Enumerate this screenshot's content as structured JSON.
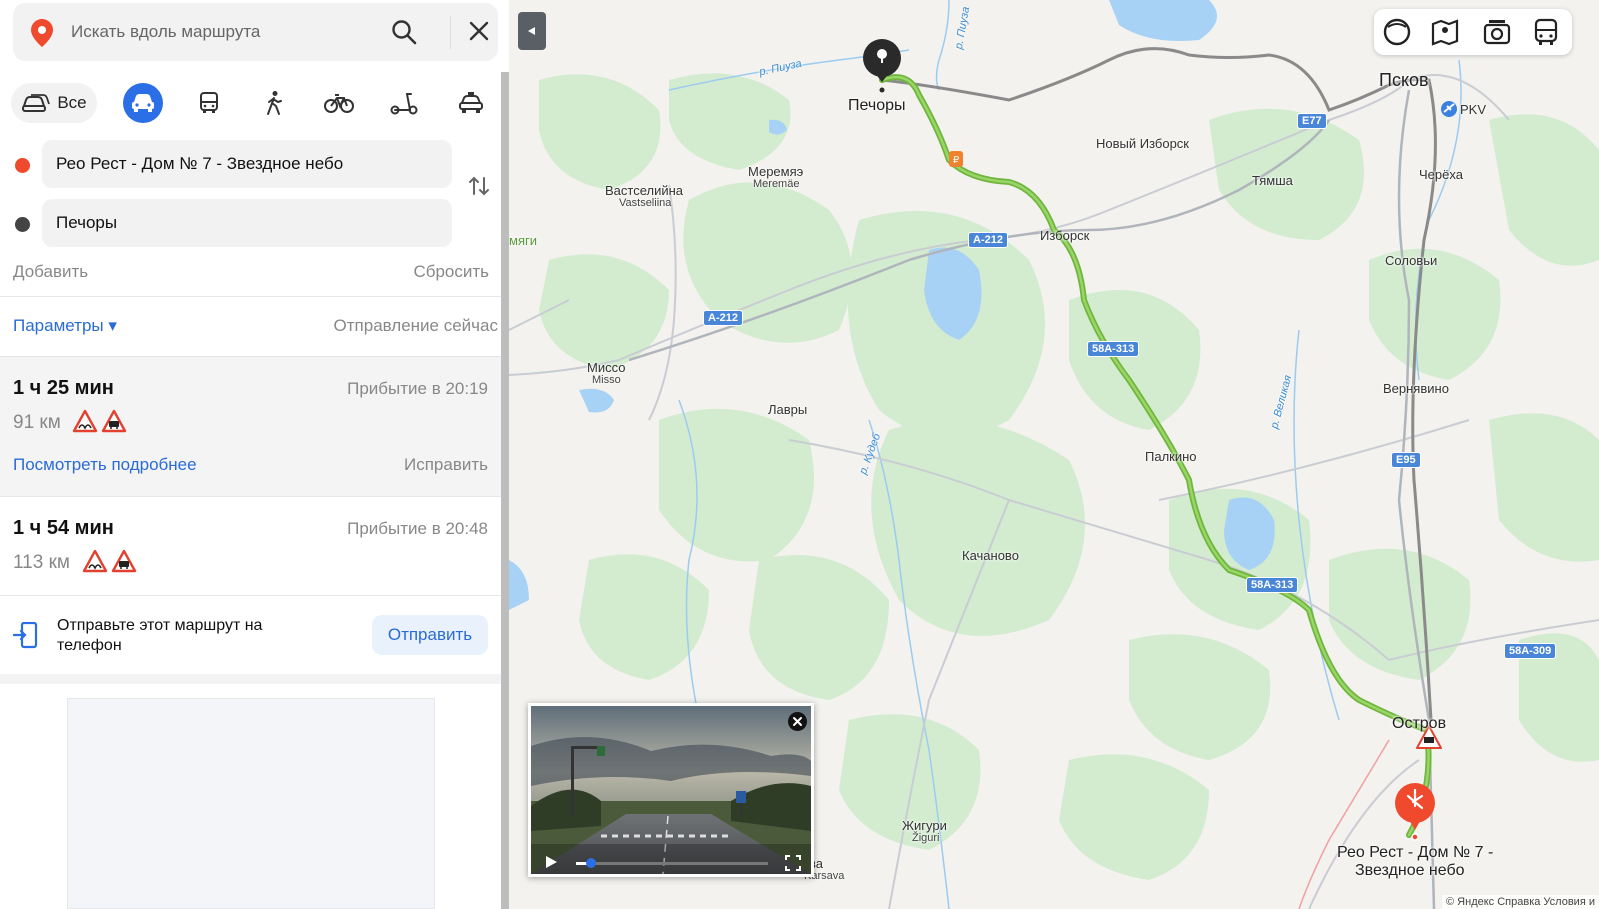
{
  "search": {
    "placeholder": "Искать вдоль маршрута"
  },
  "modes": {
    "all_label": "Все",
    "active": "car"
  },
  "points": {
    "from": "Рео Рест - Дом № 7 - Звездное небо",
    "to": "Печоры"
  },
  "actions": {
    "add": "Добавить",
    "reset": "Сбросить"
  },
  "params": {
    "label": "Параметры ▾",
    "departure": "Отправление сейчас"
  },
  "routes": [
    {
      "time": "1 ч 25 мин",
      "arrival": "Прибытие в 20:19",
      "distance": "91 км",
      "details": "Посмотреть подробнее",
      "fix": "Исправить"
    },
    {
      "time": "1 ч 54 мин",
      "arrival": "Прибытие в 20:48",
      "distance": "113 км"
    }
  ],
  "send": {
    "text": "Отправьте этот маршрут на телефон",
    "button": "Отправить"
  },
  "map": {
    "labels": {
      "pechory": "Печоры",
      "pskov": "Псков",
      "pkv": "PKV",
      "novy_izborsk": "Новый Изборск",
      "izborsk": "Изборск",
      "tyamsha": "Тямша",
      "cherekha": "Черёха",
      "solovi": "Соловьи",
      "meremyae": "Меремяэ",
      "meremae": "Meremäe",
      "vastseliina_ru": "Вастселийна",
      "vastseliina": "Vastseliina",
      "misso_ru": "Миссо",
      "misso": "Misso",
      "lavry": "Лавры",
      "palkino": "Палкино",
      "vernyavino": "Вернявино",
      "kachanovo": "Качаново",
      "ostrov": "Остров",
      "zhiguri_ru": "Жигури",
      "zhiguri": "Žiguri",
      "karsava_a": "ва",
      "karsava_b": "Karsava",
      "myagi": "мяги",
      "destination_line1": "Рео Рест - Дом № 7 -",
      "destination_line2": "Звездное небо",
      "river_piuza": "р. Пиуза",
      "river_kudeb": "р. Кудеб",
      "river_velikaya": "р. Великая",
      "river_top": "р. Пиуза"
    },
    "shields": {
      "e77": "E77",
      "a212_1": "A-212",
      "a212_2": "A-212",
      "r58a313_1": "58A-313",
      "r58a313_2": "58A-313",
      "e95": "E95",
      "r58a309": "58A-309"
    },
    "copyright": "© Яндекс  Справка  Условия и",
    "colors": {
      "route": "#7cc44a",
      "route_alt": "#8a8a8a",
      "forest": "#d3ecd0",
      "water": "#a8d2f5",
      "accent": "#2b6fe6",
      "dest": "#f04a2e"
    },
    "video": {
      "progress": 0.08
    }
  }
}
